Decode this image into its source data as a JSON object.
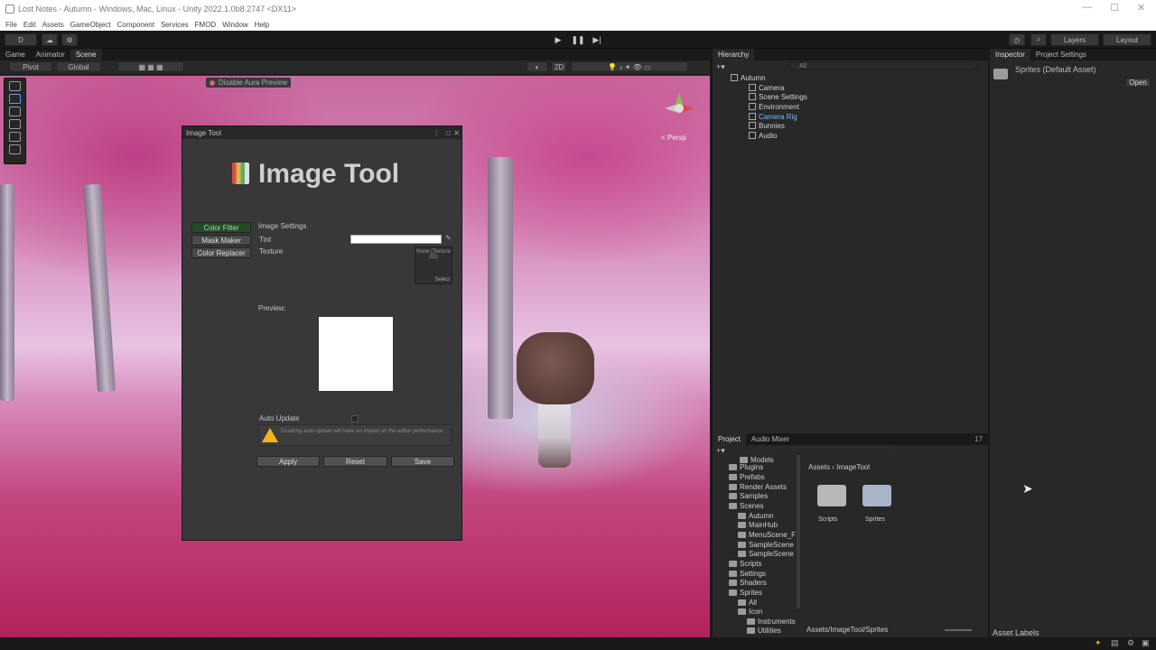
{
  "window": {
    "title": "Lost Notes - Autumn - Windows, Mac, Linux - Unity 2022.1.0b8.2747 <DX11>"
  },
  "menu": [
    "File",
    "Edit",
    "Assets",
    "GameObject",
    "Component",
    "Services",
    "FMOD",
    "Window",
    "Help"
  ],
  "toolbar": {
    "account": "D",
    "layers": "Layers",
    "layout": "Layout"
  },
  "scene_tabs": [
    "Game",
    "Animator",
    "Scene"
  ],
  "scene_tools": {
    "pivot": "Pivot",
    "global": "Global",
    "mode2d": "2D"
  },
  "aura_button": "Disable Aura Preview",
  "persp_label": "< Persp",
  "image_tool": {
    "window_title": "Image Tool",
    "heading": "Image Tool",
    "tabs": [
      "Color Filter",
      "Mask Maker",
      "Color Replacer"
    ],
    "section": "Image Settings",
    "tint_label": "Tint",
    "texture_label": "Texture",
    "texture_value": "None (Texture 2D)",
    "texture_select": "Select",
    "preview_label": "Preview:",
    "auto_update_label": "Auto Update",
    "warning": "Enabling auto update will have an impact on the editor performance",
    "buttons": [
      "Apply",
      "Reset",
      "Save"
    ]
  },
  "hierarchy": {
    "tab": "Hierarchy",
    "search": "All",
    "root": "Autumn",
    "items": [
      "Camera",
      "Scene Settings",
      "Environment",
      "Camera Rig",
      "Bunnies",
      "Audio"
    ]
  },
  "project": {
    "tabs": [
      "Project",
      "Audio Mixer"
    ],
    "breadcrumb": [
      "Assets",
      "ImageTool"
    ],
    "count": "17",
    "tree": [
      "Models",
      "Plugins",
      "Prefabs",
      "Render Assets",
      "Samples",
      "Scenes",
      "Autumn",
      "MainHub",
      "MenuScene_F",
      "SampleScene",
      "SampleScene",
      "Scripts",
      "Settings",
      "Shaders",
      "Sprites",
      "All",
      "Icon",
      "Instruments",
      "Utilities"
    ],
    "folders": [
      "Scripts",
      "Sprites"
    ],
    "path": "Assets/ImageTool/Sprites"
  },
  "inspector": {
    "tabs": [
      "Inspector",
      "Project Settings"
    ],
    "asset": "Sprites (Default Asset)",
    "open": "Open",
    "labels": "Asset Labels"
  },
  "colors": {
    "accent_green": "#244b28",
    "warning": "#f0b41f",
    "sky_pink": "#d890bf",
    "ground_magenta": "#b1225c"
  }
}
